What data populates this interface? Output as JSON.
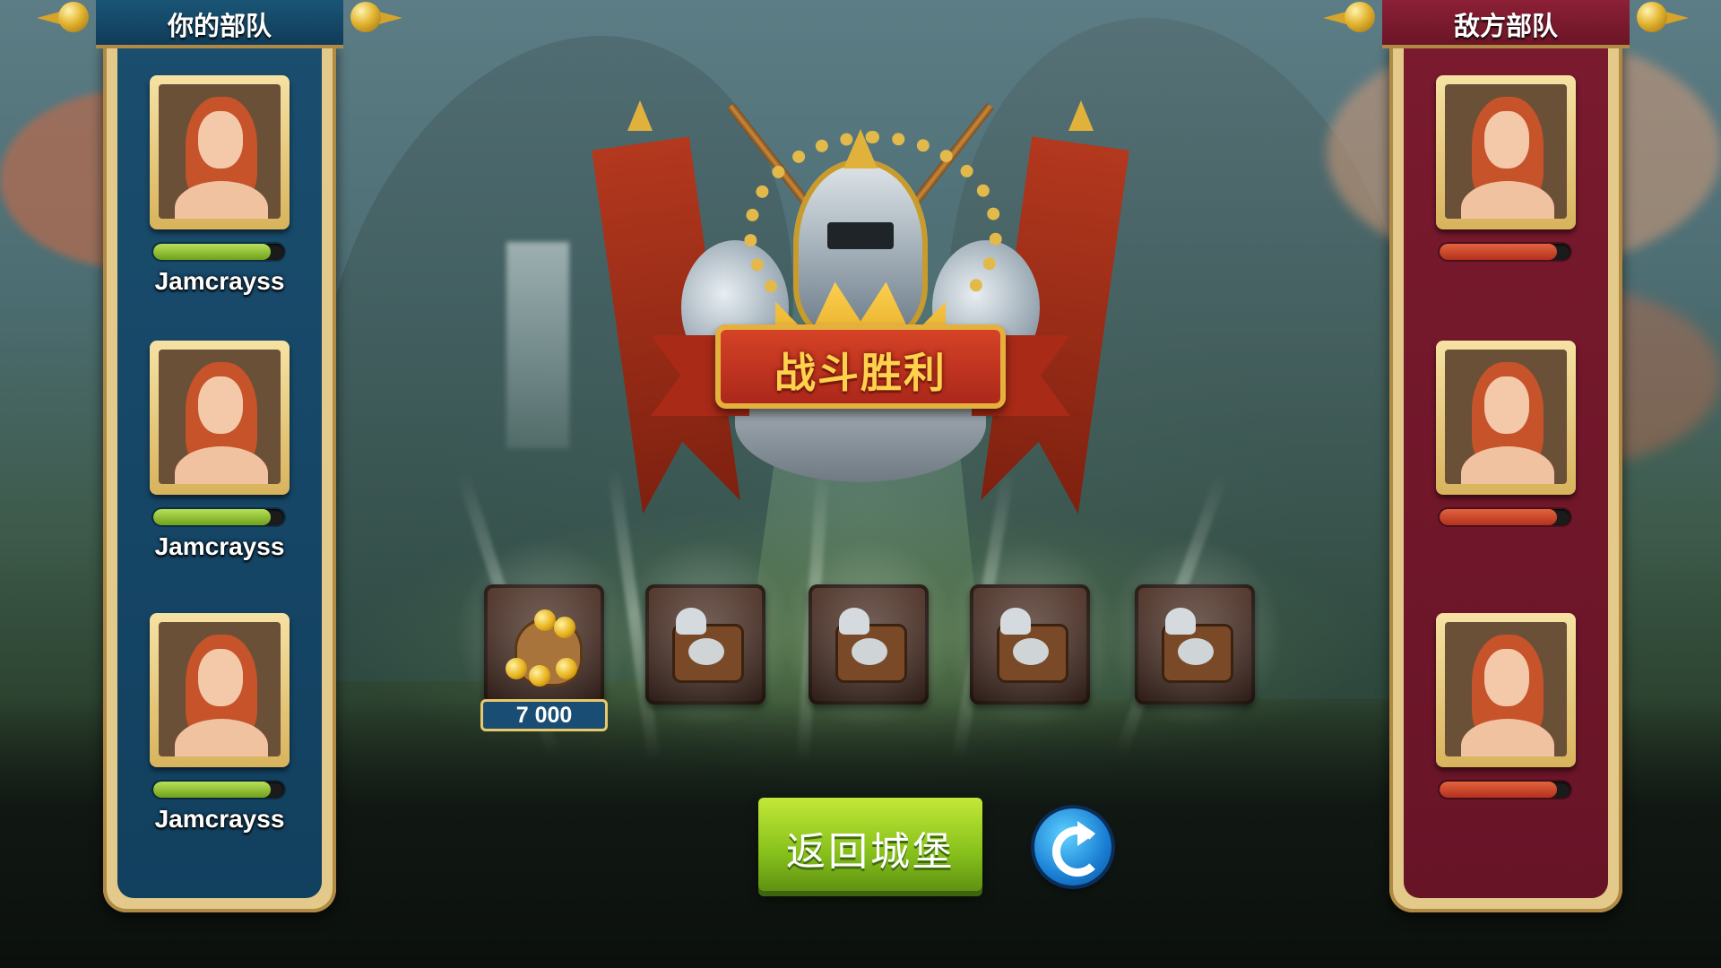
{
  "your_army": {
    "title": "你的部队",
    "units": [
      {
        "name": "Jamcrayss",
        "hp": 0.9
      },
      {
        "name": "Jamcrayss",
        "hp": 0.9
      },
      {
        "name": "Jamcrayss",
        "hp": 0.9
      }
    ]
  },
  "enemy_army": {
    "title": "敌方部队",
    "units": [
      {
        "hp": 0.9
      },
      {
        "hp": 0.9
      },
      {
        "hp": 0.9
      }
    ]
  },
  "result": {
    "title": "战斗胜利"
  },
  "rewards": [
    {
      "icon": "gold-coin-sack-icon",
      "count": "7 000"
    },
    {
      "icon": "catapult-pack-icon"
    },
    {
      "icon": "catapult-pack-icon"
    },
    {
      "icon": "catapult-pack-icon"
    },
    {
      "icon": "catapult-pack-icon"
    }
  ],
  "buttons": {
    "back": "返回城堡",
    "replay_icon": "replay-icon"
  },
  "colors": {
    "ally_panel": "#1a4d6e",
    "enemy_panel": "#7a1a2e",
    "ally_hp": "#8bc12a",
    "enemy_hp": "#c9391f",
    "back_button": "#8cc31c",
    "banner_text": "#ffd24d"
  }
}
